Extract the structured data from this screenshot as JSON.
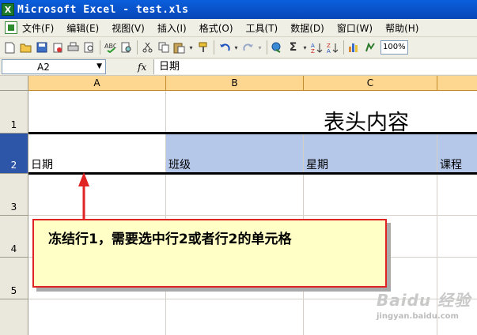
{
  "window": {
    "title": "Microsoft Excel - test.xls"
  },
  "menu": {
    "items": [
      "文件(F)",
      "编辑(E)",
      "视图(V)",
      "插入(I)",
      "格式(O)",
      "工具(T)",
      "数据(D)",
      "窗口(W)",
      "帮助(H)"
    ]
  },
  "toolbar": {
    "zoom": "100%",
    "icons": [
      "new-file-icon",
      "open-folder-icon",
      "save-icon",
      "permission-icon",
      "print-icon",
      "print-preview-icon",
      "spelling-icon",
      "research-icon",
      "cut-icon",
      "copy-icon",
      "paste-icon",
      "format-painter-icon",
      "undo-icon",
      "redo-icon",
      "hyperlink-icon",
      "autosum-icon",
      "sort-ascending-icon",
      "sort-descending-icon",
      "chart-wizard-icon",
      "drawing-icon"
    ]
  },
  "formula_bar": {
    "name_box": "A2",
    "fx_label": "fx",
    "content": "日期"
  },
  "sheet": {
    "columns": [
      "A",
      "B",
      "C"
    ],
    "rows": [
      "1",
      "2",
      "3",
      "4",
      "5"
    ],
    "header_content": "表头内容",
    "row2": [
      "日期",
      "班级",
      "星期",
      "课程"
    ],
    "active_row": "2"
  },
  "callout": {
    "text": "冻结行1，需要选中行2或者行2的单元格",
    "border_color": "#e02424",
    "fill_color": "#ffffc6"
  },
  "watermark": {
    "logo": "Baidu 经验",
    "url": "jingyan.baidu.com"
  }
}
